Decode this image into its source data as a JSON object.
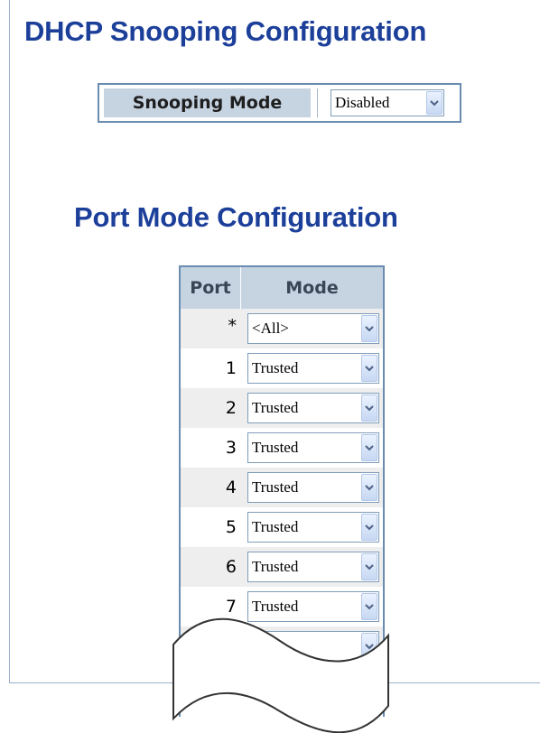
{
  "dhcp": {
    "title": "DHCP Snooping Configuration",
    "snooping_mode_label": "Snooping Mode",
    "snooping_mode_value": "Disabled"
  },
  "port_mode": {
    "title": "Port Mode Configuration",
    "columns": [
      "Port",
      "Mode"
    ],
    "rows": [
      {
        "port": "*",
        "mode": "<All>"
      },
      {
        "port": "1",
        "mode": "Trusted"
      },
      {
        "port": "2",
        "mode": "Trusted"
      },
      {
        "port": "3",
        "mode": "Trusted"
      },
      {
        "port": "4",
        "mode": "Trusted"
      },
      {
        "port": "5",
        "mode": "Trusted"
      },
      {
        "port": "6",
        "mode": "Trusted"
      },
      {
        "port": "7",
        "mode": "Trusted"
      }
    ]
  },
  "colors": {
    "title": "#1c3f9a",
    "header_bg": "#c6d3e1",
    "row_shade": "#eeeeee",
    "border": "#6a8cb0"
  },
  "icons": {
    "dropdown": "chevron-down-icon",
    "table_break": "wavy-break-icon"
  }
}
